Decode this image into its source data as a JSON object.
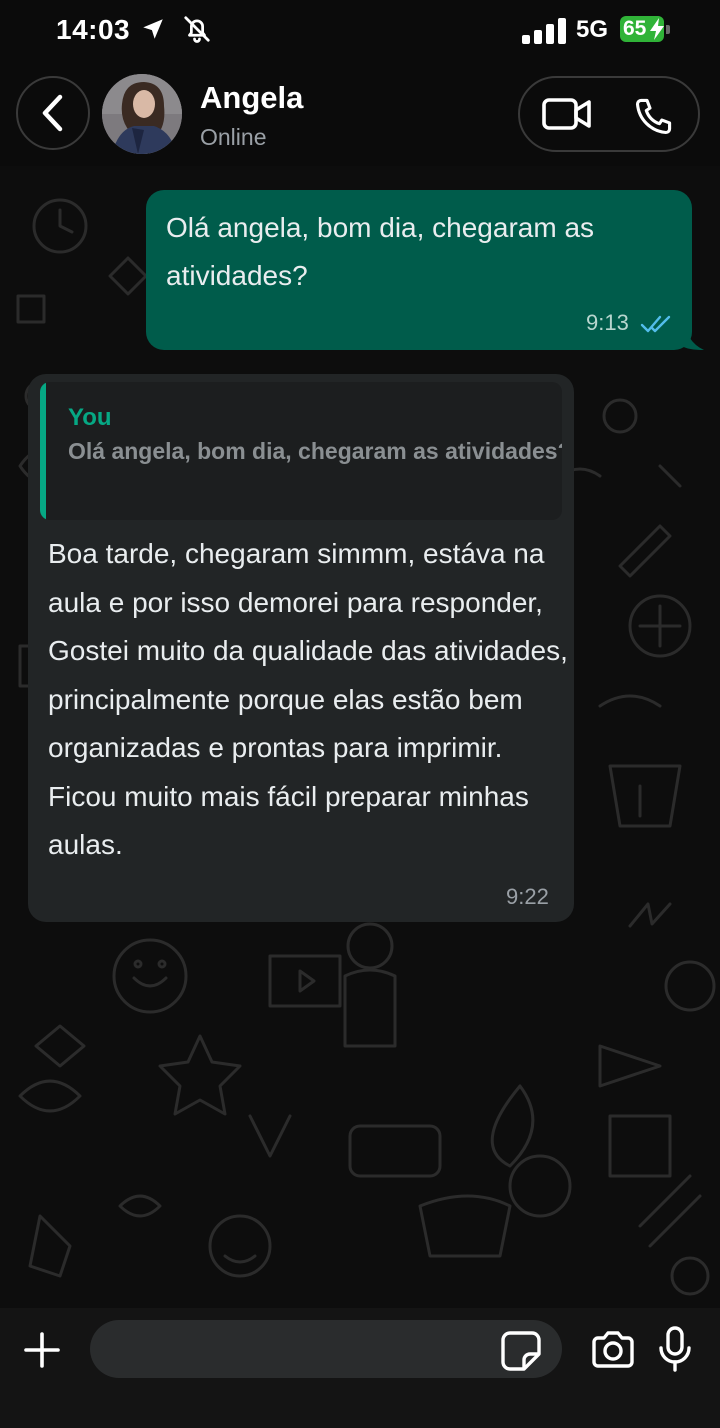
{
  "status_bar": {
    "time": "14:03",
    "network": "5G",
    "battery": "65",
    "icons": [
      "location-arrow-icon",
      "bell-off-icon",
      "signal-bars-icon",
      "battery-charging-icon"
    ]
  },
  "header": {
    "contact_name": "Angela",
    "contact_status": "Online",
    "icons": [
      "back-chevron-icon",
      "video-call-icon",
      "phone-call-icon"
    ]
  },
  "messages": [
    {
      "direction": "outgoing",
      "text": "Olá angela, bom dia, chegaram as atividades?",
      "time": "9:13",
      "status": "read"
    },
    {
      "direction": "incoming",
      "quote": {
        "author": "You",
        "text": "Olá angela, bom dia, chegaram as atividades?"
      },
      "text": "Boa tarde, chegaram simmm, estáva na aula e por isso demorei para responder, Gostei muito da qualidade das atividades, principalmente porque elas estão bem organizadas e prontas para imprimir. Ficou muito mais fácil preparar minhas aulas.",
      "time": "9:22"
    }
  ],
  "input_bar": {
    "value": "",
    "icons": [
      "plus-icon",
      "sticker-icon",
      "camera-icon",
      "microphone-icon"
    ]
  },
  "colors": {
    "outgoing_bubble": "#005c4b",
    "incoming_bubble": "#222526",
    "accent": "#06a884",
    "read_ticks": "#53bdeb",
    "battery": "#30b338"
  }
}
